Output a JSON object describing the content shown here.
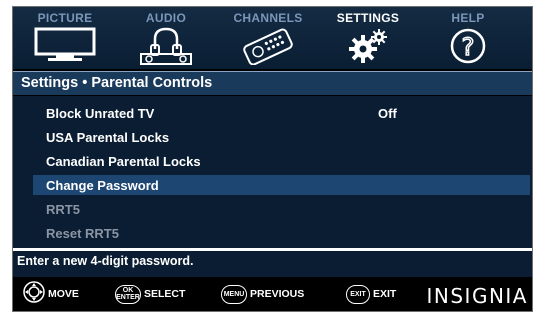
{
  "tabs": [
    {
      "label": "PICTURE",
      "icon": "tv-icon",
      "active": false
    },
    {
      "label": "AUDIO",
      "icon": "speaker-icon",
      "active": false
    },
    {
      "label": "CHANNELS",
      "icon": "remote-icon",
      "active": false
    },
    {
      "label": "SETTINGS",
      "icon": "gears-icon",
      "active": true
    },
    {
      "label": "HELP",
      "icon": "question-icon",
      "active": false
    }
  ],
  "panel": {
    "title": "Settings • Parental Controls"
  },
  "menu": {
    "items": [
      {
        "label": "Block Unrated TV",
        "value": "Off",
        "state": "normal"
      },
      {
        "label": "USA Parental Locks",
        "value": "",
        "state": "normal"
      },
      {
        "label": "Canadian Parental Locks",
        "value": "",
        "state": "normal"
      },
      {
        "label": "Change Password",
        "value": "",
        "state": "selected"
      },
      {
        "label": "RRT5",
        "value": "",
        "state": "dim"
      },
      {
        "label": "Reset RRT5",
        "value": "",
        "state": "dim"
      }
    ]
  },
  "hint": "Enter a new 4-digit password.",
  "footer": {
    "move": {
      "icon": "dpad-icon",
      "label": "MOVE"
    },
    "select": {
      "key": "OK ENTER",
      "key_top": "OK",
      "key_bottom": "ENTER",
      "label": "SELECT"
    },
    "previous": {
      "key": "MENU",
      "label": "PREVIOUS"
    },
    "exit": {
      "key": "EXIT",
      "label": "EXIT"
    },
    "brand": "INSIGNIA"
  },
  "colors": {
    "panel_bg": "#0a1d33",
    "title_bg": "#1a3a5c",
    "selected_bg": "#1d4772",
    "tab_label": "#7a96b8",
    "dim_text": "#8b95a3"
  }
}
